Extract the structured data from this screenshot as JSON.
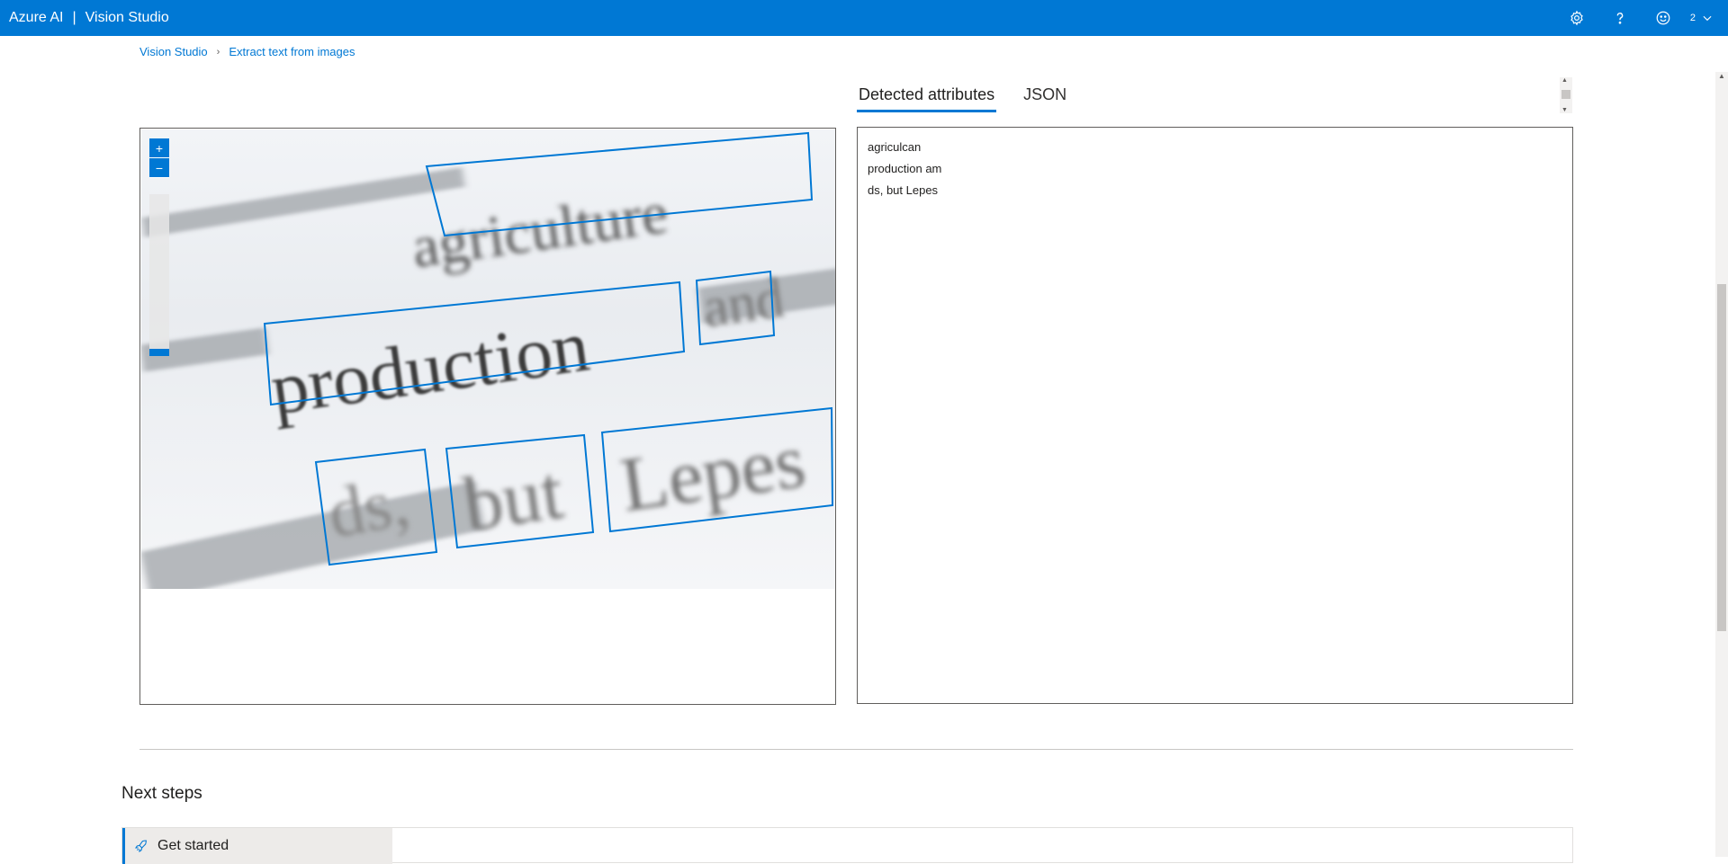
{
  "header": {
    "brand": "Azure AI",
    "separator": "|",
    "product": "Vision Studio",
    "account_badge": "2",
    "icons": [
      "gear-icon",
      "help-icon",
      "smiley-icon",
      "chevron-down-icon"
    ]
  },
  "breadcrumb": {
    "items": [
      "Vision Studio",
      "Extract text from images"
    ],
    "separator": "›"
  },
  "tabs": [
    {
      "label": "Detected attributes",
      "active": true
    },
    {
      "label": "JSON",
      "active": false
    }
  ],
  "image_viewer": {
    "zoom_in_label": "+",
    "zoom_out_label": "−",
    "zoom_level": 0,
    "image_words": [
      "agriculture",
      "production",
      "and",
      "ds,",
      "but",
      "Lepes"
    ]
  },
  "attributes": {
    "lines": [
      "agriculcan",
      "production am",
      "ds, but Lepes"
    ]
  },
  "next_steps": {
    "title": "Next steps",
    "tab_label": "Get started"
  },
  "colors": {
    "accent": "#0078d4",
    "topbar": "#0078d4",
    "text": "#201f1e"
  }
}
